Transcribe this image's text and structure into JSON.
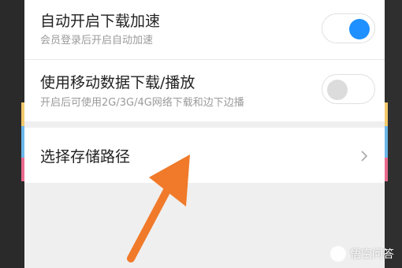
{
  "settings": {
    "auto_speedup": {
      "title": "自动开启下载加速",
      "subtitle": "会员登录后开启自动加速",
      "enabled": true
    },
    "mobile_data": {
      "title": "使用移动数据下载/播放",
      "subtitle": "开启后可使用2G/3G/4G网络下载和边下边播",
      "enabled": false
    },
    "storage_path": {
      "title": "选择存储路径"
    }
  },
  "watermark": {
    "text": "悟空问答"
  },
  "colors": {
    "toggle_on": "#1e90ff",
    "toggle_off": "#dcdcdc",
    "arrow": "#f07a2a"
  }
}
